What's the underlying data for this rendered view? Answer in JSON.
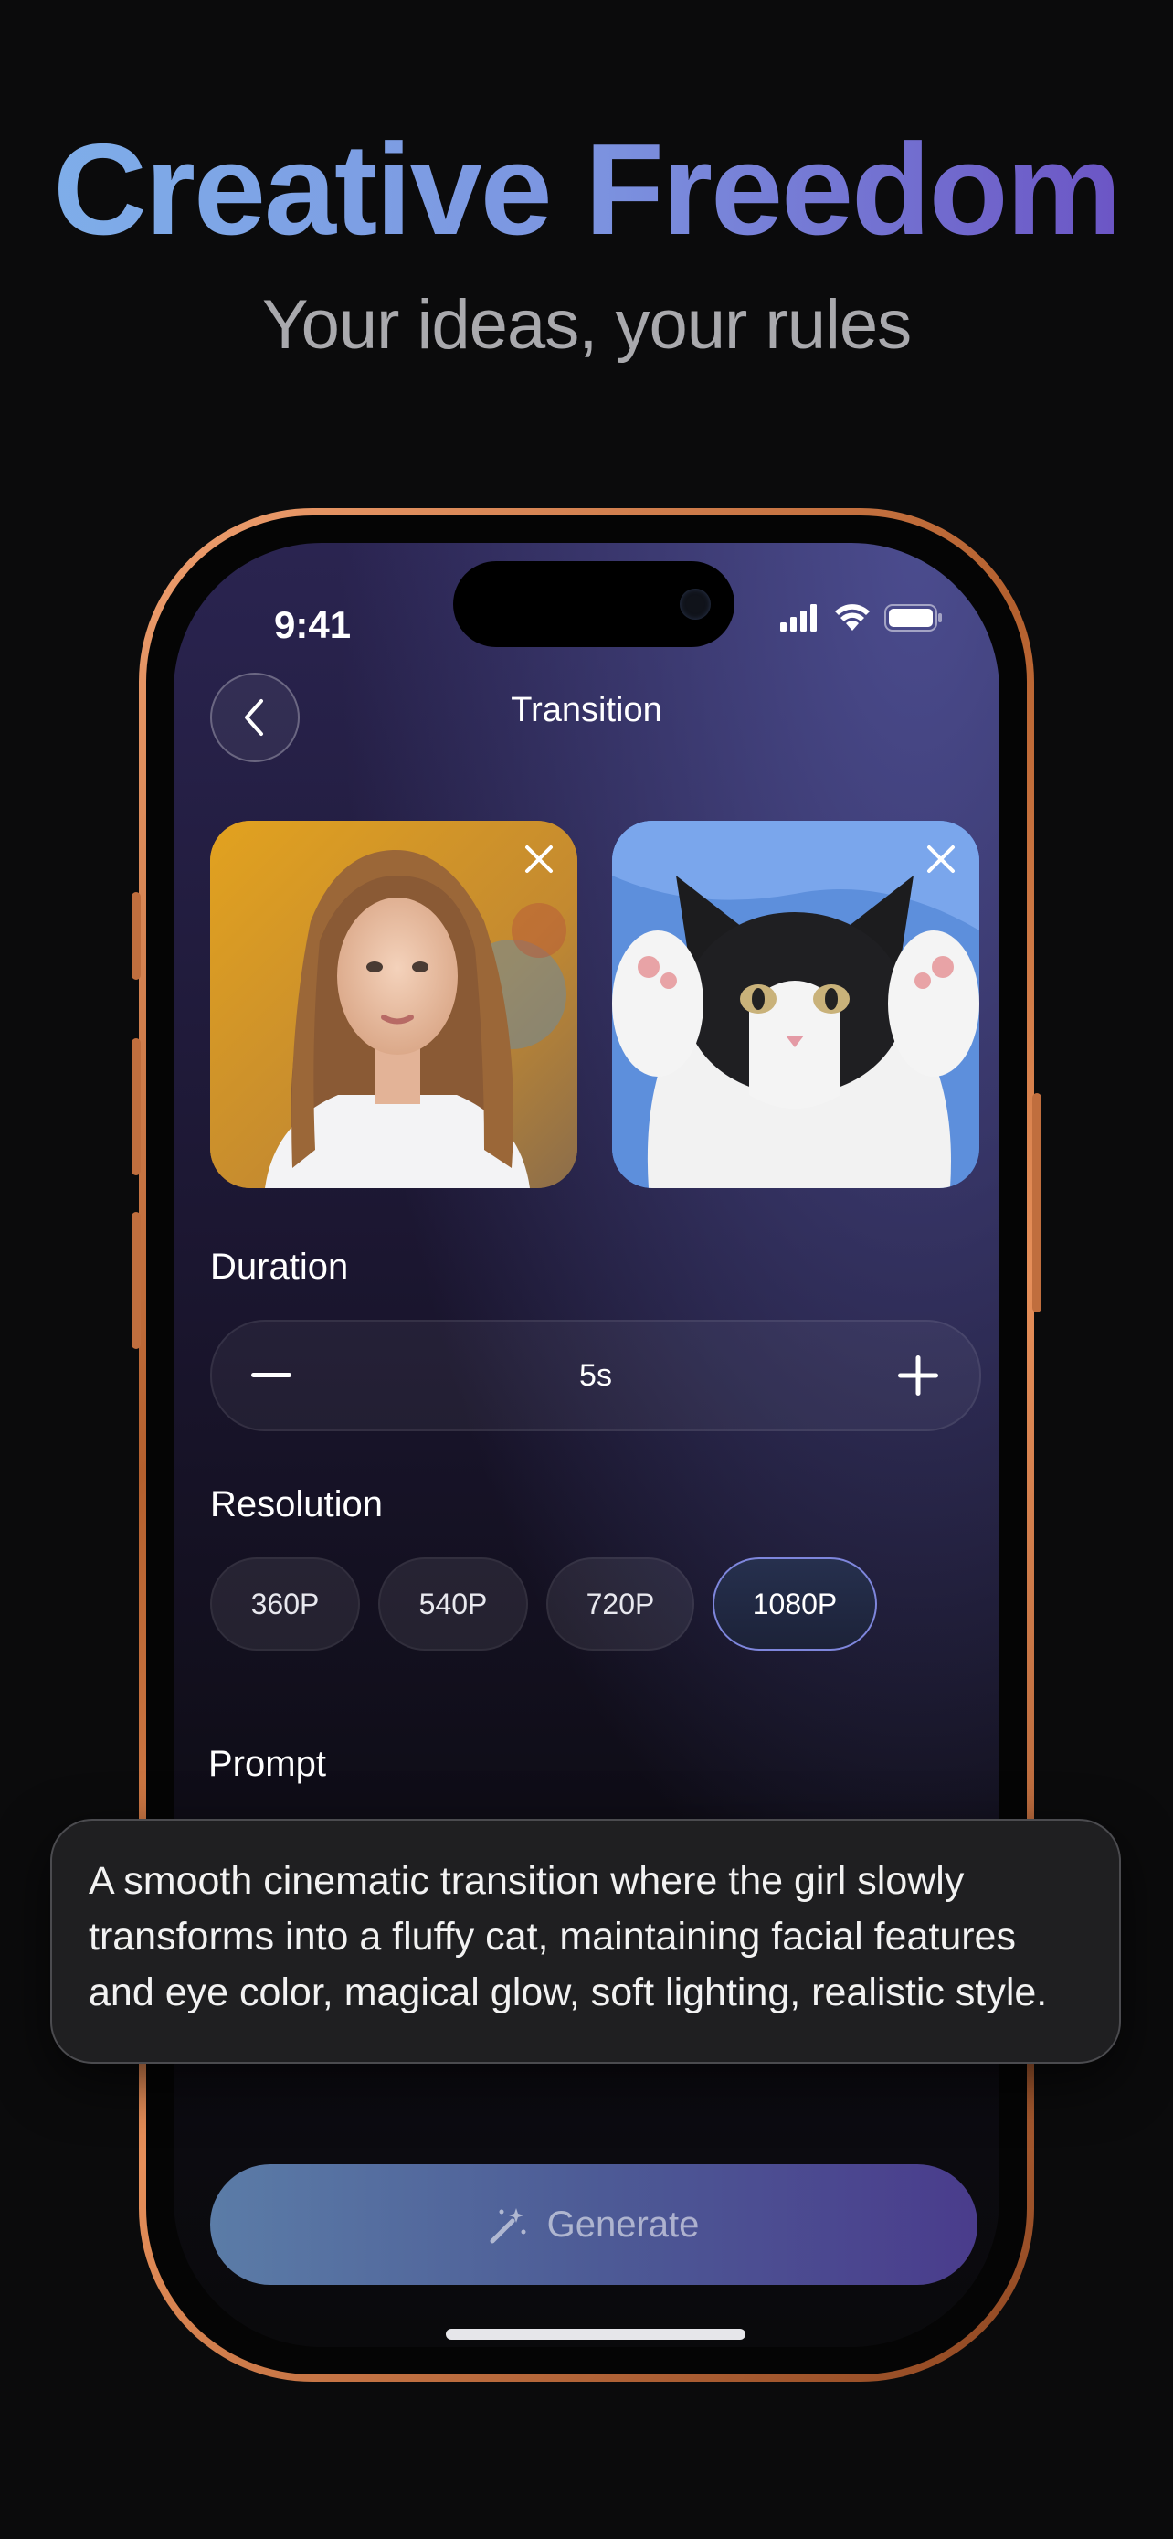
{
  "hero": {
    "title": "Creative Freedom",
    "subtitle": "Your ideas, your rules"
  },
  "status_bar": {
    "time": "9:41",
    "icons": [
      "cellular-signal-icon",
      "wifi-icon",
      "battery-icon"
    ]
  },
  "header": {
    "title": "Transition",
    "back_icon": "chevron-left-icon"
  },
  "images": [
    {
      "subject": "girl-photo",
      "remove_icon": "close-icon"
    },
    {
      "subject": "cat-photo",
      "remove_icon": "close-icon"
    }
  ],
  "duration": {
    "label": "Duration",
    "value": "5s"
  },
  "resolution": {
    "label": "Resolution",
    "options": [
      "360P",
      "540P",
      "720P",
      "1080P"
    ],
    "selected": "1080P"
  },
  "prompt": {
    "label": "Prompt",
    "text": "A smooth cinematic transition where the girl slowly transforms into a fluffy cat, maintaining facial features and eye color, magical glow, soft lighting, realistic style."
  },
  "generate_button": {
    "label": "Generate",
    "icon": "magic-wand-icon"
  },
  "colors": {
    "background": "#0b0b0c",
    "headline_gradient_start": "#7fb0ea",
    "headline_gradient_end": "#6a4fc2",
    "phone_frame": "#d98150",
    "active_chip_border": "#7e86dc"
  }
}
